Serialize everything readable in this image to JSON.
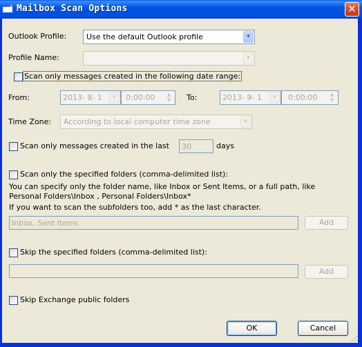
{
  "window": {
    "title": "Mailbox Scan Options",
    "close_label": "✕"
  },
  "outlook_profile": {
    "label": "Outlook Profile:",
    "value": "Use the default Outlook profile"
  },
  "profile_name": {
    "label": "Profile Name:",
    "value": ""
  },
  "date_range": {
    "checkbox_label": "Scan only messages created in the following date range:",
    "checked": false,
    "from_label": "From:",
    "from_date": "2013- 8- 1",
    "from_time": "0:00:00",
    "to_label": "To:",
    "to_date": "2013- 9- 1",
    "to_time": "0:00:00"
  },
  "time_zone": {
    "label": "Time Zone:",
    "value": "According to local computer time zone"
  },
  "last_days": {
    "checkbox_label": "Scan only messages created in the last",
    "checked": false,
    "value": "30",
    "unit": "days"
  },
  "scan_folders": {
    "checkbox_label": "Scan only the specified folders (comma-delimited list):",
    "checked": false,
    "help_line1": "You can specify only the folder name, like Inbox or Sent Items, or a full path, like",
    "help_line2": "Personal Folders\\Inbox , Personal Folders\\Inbox*",
    "help_line3": "If you want to scan the subfolders too, add * as the last character.",
    "placeholder": "Inbox, Sent Items",
    "add_label": "Add"
  },
  "skip_folders": {
    "checkbox_label": "Skip the specified folders (comma-delimited list):",
    "checked": false,
    "value": "",
    "add_label": "Add"
  },
  "skip_public": {
    "checkbox_label": "Skip Exchange public folders",
    "checked": false
  },
  "buttons": {
    "ok": "OK",
    "cancel": "Cancel"
  },
  "icons": {
    "dropdown": "▾",
    "spin_up": "▲",
    "spin_down": "▼"
  }
}
